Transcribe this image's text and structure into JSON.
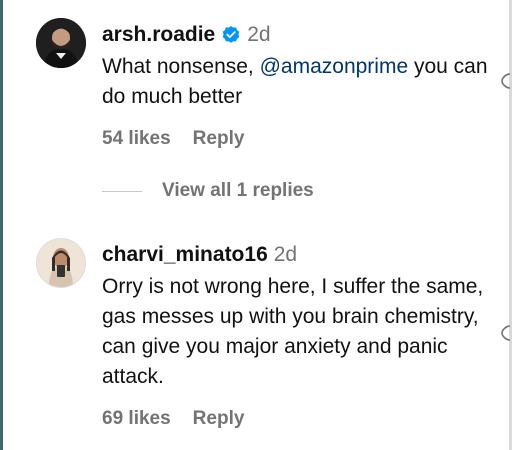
{
  "comments": [
    {
      "username": "arsh.roadie",
      "verified": true,
      "time": "2d",
      "text_before": "What nonsense, ",
      "mention": "@amazonprime",
      "text_after": " you can do much better",
      "likes": "54 likes",
      "reply": "Reply"
    },
    {
      "username": "charvi_minato16",
      "verified": false,
      "time": "2d",
      "text": "Orry is not wrong here, I suffer the same, gas messes up with you brain chemistry, can give you major anxiety and panic attack.",
      "likes": "69 likes",
      "reply": "Reply"
    }
  ],
  "view_replies": "View all 1 replies",
  "colors": {
    "muted": "#737373",
    "mention": "#00376b",
    "verified": "#0095f6"
  }
}
